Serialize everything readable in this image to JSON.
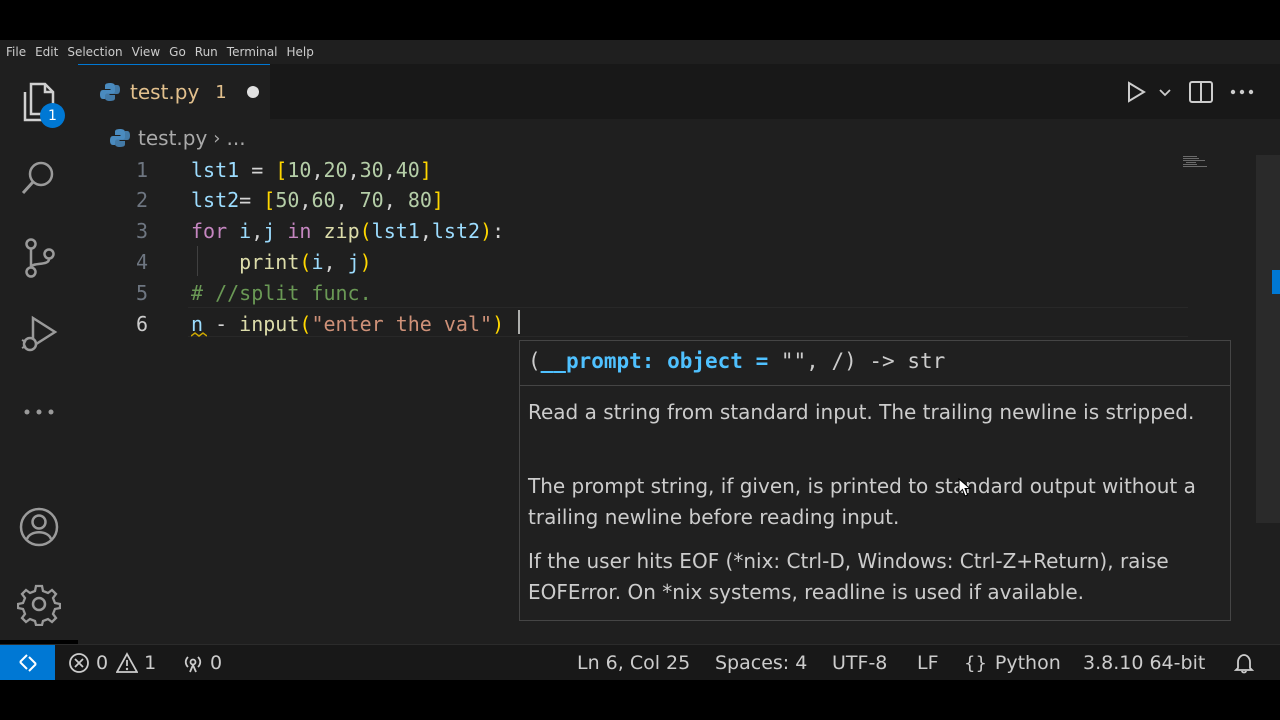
{
  "menu": [
    "File",
    "Edit",
    "Selection",
    "View",
    "Go",
    "Run",
    "Terminal",
    "Help"
  ],
  "activity_bar": {
    "explorer_badge": "1",
    "icons": [
      "files-icon",
      "search-icon",
      "source-control-icon",
      "run-debug-icon",
      "more-icon",
      "account-icon",
      "settings-gear-icon"
    ]
  },
  "tab": {
    "filename": "test.py",
    "problem_count": "1"
  },
  "breadcrumb": {
    "file": "test.py",
    "more": "..."
  },
  "editor": {
    "line_numbers": [
      "1",
      "2",
      "3",
      "4",
      "5",
      "6"
    ],
    "active_line": "6",
    "lines": [
      [
        {
          "t": "lst1",
          "c": "var"
        },
        {
          "t": " = ",
          "c": "plain"
        },
        {
          "t": "[",
          "c": "br1"
        },
        {
          "t": "10",
          "c": "num"
        },
        {
          "t": ",",
          "c": "plain"
        },
        {
          "t": "20",
          "c": "num"
        },
        {
          "t": ",",
          "c": "plain"
        },
        {
          "t": "30",
          "c": "num"
        },
        {
          "t": ",",
          "c": "plain"
        },
        {
          "t": "40",
          "c": "num"
        },
        {
          "t": "]",
          "c": "br1"
        }
      ],
      [
        {
          "t": "lst2",
          "c": "var"
        },
        {
          "t": "= ",
          "c": "plain"
        },
        {
          "t": "[",
          "c": "br1"
        },
        {
          "t": "50",
          "c": "num"
        },
        {
          "t": ",",
          "c": "plain"
        },
        {
          "t": "60",
          "c": "num"
        },
        {
          "t": ", ",
          "c": "plain"
        },
        {
          "t": "70",
          "c": "num"
        },
        {
          "t": ", ",
          "c": "plain"
        },
        {
          "t": "80",
          "c": "num"
        },
        {
          "t": "]",
          "c": "br1"
        }
      ],
      [
        {
          "t": "for",
          "c": "kw"
        },
        {
          "t": " ",
          "c": "plain"
        },
        {
          "t": "i",
          "c": "var"
        },
        {
          "t": ",",
          "c": "plain"
        },
        {
          "t": "j",
          "c": "var"
        },
        {
          "t": " ",
          "c": "plain"
        },
        {
          "t": "in",
          "c": "kw"
        },
        {
          "t": " ",
          "c": "plain"
        },
        {
          "t": "zip",
          "c": "fn"
        },
        {
          "t": "(",
          "c": "br1"
        },
        {
          "t": "lst1",
          "c": "var"
        },
        {
          "t": ",",
          "c": "plain"
        },
        {
          "t": "lst2",
          "c": "var"
        },
        {
          "t": ")",
          "c": "br1"
        },
        {
          "t": ":",
          "c": "plain"
        }
      ],
      [
        {
          "t": "    ",
          "c": "plain"
        },
        {
          "t": "print",
          "c": "fn"
        },
        {
          "t": "(",
          "c": "br1"
        },
        {
          "t": "i",
          "c": "var"
        },
        {
          "t": ", ",
          "c": "plain"
        },
        {
          "t": "j",
          "c": "var"
        },
        {
          "t": ")",
          "c": "br1"
        }
      ],
      [
        {
          "t": "# //split func.",
          "c": "cm"
        }
      ],
      [
        {
          "t": "n",
          "c": "var"
        },
        {
          "t": " - ",
          "c": "plain"
        },
        {
          "t": "input",
          "c": "fn"
        },
        {
          "t": "(",
          "c": "br1"
        },
        {
          "t": "\"enter the val\"",
          "c": "str"
        },
        {
          "t": ")",
          "c": "br1"
        }
      ]
    ]
  },
  "hover": {
    "signature": [
      {
        "t": "(",
        "c": "plain"
      },
      {
        "t": "__prompt: object = ",
        "c": "var-b"
      },
      {
        "t": "\"\"",
        "c": "plain"
      },
      {
        "t": ", /) -> str",
        "c": "plain"
      }
    ],
    "paragraphs": [
      "Read a string from standard input. The trailing newline is stripped.",
      "The prompt string, if given, is printed to standard output without a trailing newline before reading input.",
      "If the user hits EOF (*nix: Ctrl-D, Windows: Ctrl-Z+Return), raise EOFError. On *nix systems, readline is used if available."
    ]
  },
  "status": {
    "errors": "0",
    "warnings": "1",
    "ports": "0",
    "cursor_position": "Ln 6, Col 25",
    "indentation": "Spaces: 4",
    "encoding": "UTF-8",
    "eol": "LF",
    "language": "Python",
    "interpreter": "3.8.10 64-bit"
  },
  "colors": {
    "accent": "#0078d4",
    "modified_tab_text": "#e2c08d"
  }
}
